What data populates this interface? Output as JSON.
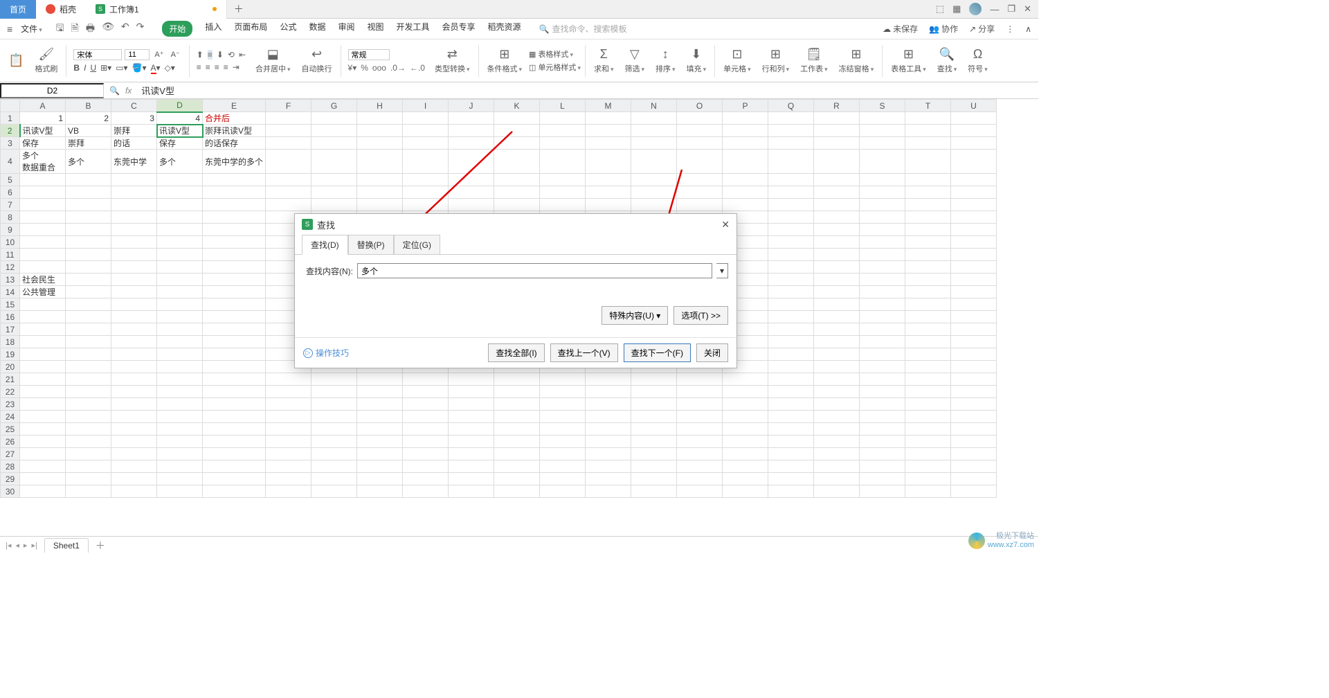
{
  "tabs": {
    "home": "首页",
    "daoke": "稻壳",
    "workbook": "工作簿1"
  },
  "menu": {
    "file": "文件",
    "ribbon_tabs": [
      "开始",
      "插入",
      "页面布局",
      "公式",
      "数据",
      "审阅",
      "视图",
      "开发工具",
      "会员专享",
      "稻壳资源"
    ],
    "search_placeholder": "查找命令、搜索模板",
    "unsaved": "未保存",
    "collab": "协作",
    "share": "分享"
  },
  "ribbon": {
    "paste_brush": "格式刷",
    "font_name": "宋体",
    "font_size": "11",
    "merge": "合并居中",
    "wrap": "自动换行",
    "number_format": "常规",
    "type_convert": "类型转换",
    "cond_format": "条件格式",
    "table_style": "表格样式",
    "cell_style": "单元格样式",
    "sum": "求和",
    "filter": "筛选",
    "sort": "排序",
    "fill": "填充",
    "cell": "单元格",
    "rowcol": "行和列",
    "sheet": "工作表",
    "freeze": "冻结窗格",
    "table_tools": "表格工具",
    "find": "查找",
    "symbol": "符号"
  },
  "namebox": "D2",
  "formula": "讯读V型",
  "columns": [
    "A",
    "B",
    "C",
    "D",
    "E",
    "F",
    "G",
    "H",
    "I",
    "J",
    "K",
    "L",
    "M",
    "N",
    "O",
    "P",
    "Q",
    "R",
    "S",
    "T",
    "U"
  ],
  "cells": {
    "r1": {
      "A": "1",
      "B": "2",
      "C": "3",
      "D": "4",
      "E": "合并后"
    },
    "r2": {
      "A": "讯读V型",
      "B": "VB",
      "C": "崇拜",
      "D": "讯读V型",
      "E": "崇拜讯读V型"
    },
    "r3": {
      "A": "保存",
      "B": "崇拜",
      "C": "的话",
      "D": "保存",
      "E": "的话保存"
    },
    "r4": {
      "A": "多个\n数据重合",
      "B": "多个",
      "C": "东莞中学",
      "D": "多个",
      "E": "东莞中学的多个"
    },
    "r13": {
      "A": "社会民生"
    },
    "r14": {
      "A": "公共管理"
    }
  },
  "sheet_tab": "Sheet1",
  "dialog": {
    "title": "查找",
    "tab_find": "查找(D)",
    "tab_replace": "替换(P)",
    "tab_goto": "定位(G)",
    "label_find": "查找内容(N):",
    "find_value": "多个",
    "special": "特殊内容(U)",
    "options": "选项(T) >>",
    "tips": "操作技巧",
    "find_all": "查找全部(I)",
    "find_prev": "查找上一个(V)",
    "find_next": "查找下一个(F)",
    "close": "关闭"
  },
  "watermark": {
    "name": "极光下载站",
    "url": "www.xz7.com"
  }
}
